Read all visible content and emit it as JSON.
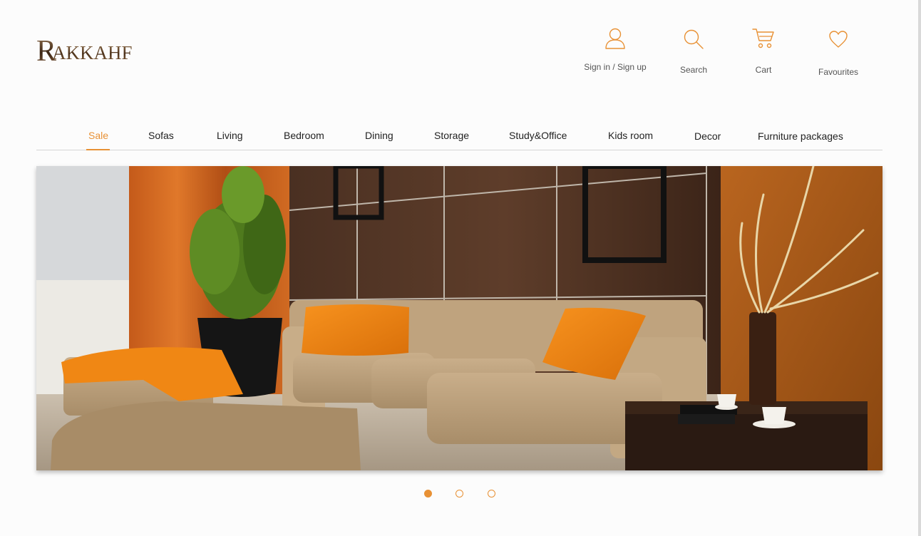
{
  "logo": {
    "initial": "R",
    "rest": "AKKAHF"
  },
  "header": {
    "signin": {
      "label": "Sign in / Sign up",
      "icon": "user-icon"
    },
    "search": {
      "label": "Search",
      "icon": "search-icon"
    },
    "cart": {
      "label": "Cart",
      "icon": "cart-icon"
    },
    "favourites": {
      "label": "Favourites",
      "icon": "heart-icon"
    }
  },
  "nav": {
    "items": [
      {
        "label": "Sale",
        "active": true
      },
      {
        "label": "Sofas"
      },
      {
        "label": "Living"
      },
      {
        "label": "Bedroom"
      },
      {
        "label": "Dining"
      },
      {
        "label": "Storage"
      },
      {
        "label": "Study&Office"
      },
      {
        "label": "Kids room"
      },
      {
        "label": "Decor"
      },
      {
        "label": "Furniture packages"
      }
    ]
  },
  "carousel": {
    "slides_total": 3,
    "active_index": 0
  },
  "colors": {
    "accent": "#e89135",
    "text": "#222222",
    "muted": "#555555",
    "divider": "#d6d6d6"
  }
}
